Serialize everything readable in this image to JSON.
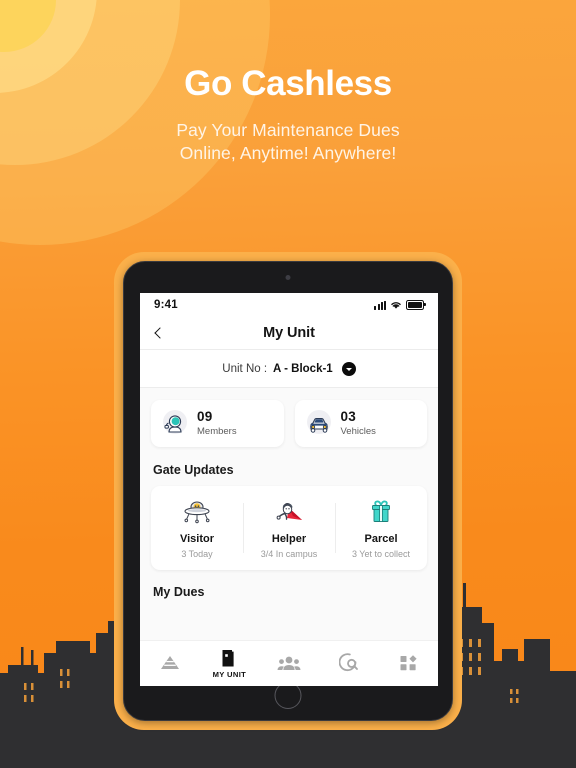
{
  "promo": {
    "headline": "Go Cashless",
    "subline_1": "Pay Your Maintenance Dues",
    "subline_2": "Online, Anytime! Anywhere!",
    "background_color": "#F98A1C",
    "sun_color": "#FDD45C",
    "skyline_color": "#2F2F31"
  },
  "device": {
    "frame_color": "#1A1A1C",
    "halo_color": "#FBB04A"
  },
  "status_bar": {
    "time": "9:41",
    "signal_icon": "cellular-bars-icon",
    "wifi_icon": "wifi-icon",
    "battery_icon": "battery-full-icon"
  },
  "app_header": {
    "back_icon": "chevron-left-icon",
    "title": "My Unit"
  },
  "unit_selector": {
    "label": "Unit No :",
    "value": "A - Block-1",
    "caret_icon": "chevron-down-circle-icon"
  },
  "stats": [
    {
      "icon": "astronaut-member-icon",
      "count": "09",
      "caption": "Members"
    },
    {
      "icon": "car-front-icon",
      "count": "03",
      "caption": "Vehicles"
    }
  ],
  "gate_updates": {
    "title": "Gate Updates",
    "items": [
      {
        "icon": "ufo-visitor-icon",
        "name": "Visitor",
        "detail": "3 Today"
      },
      {
        "icon": "superhero-helper-icon",
        "name": "Helper",
        "detail": "3/4 In campus"
      },
      {
        "icon": "gift-parcel-icon",
        "name": "Parcel",
        "detail": "3 Yet to collect"
      }
    ]
  },
  "dues": {
    "title": "My Dues"
  },
  "tab_bar": {
    "items": [
      {
        "icon": "home-triangle-icon",
        "label": "",
        "active": false
      },
      {
        "icon": "door-icon",
        "label": "MY UNIT",
        "active": true
      },
      {
        "icon": "community-people-icon",
        "label": "",
        "active": false
      },
      {
        "icon": "discover-search-icon",
        "label": "",
        "active": false
      },
      {
        "icon": "grid-apps-icon",
        "label": "",
        "active": false
      }
    ]
  }
}
